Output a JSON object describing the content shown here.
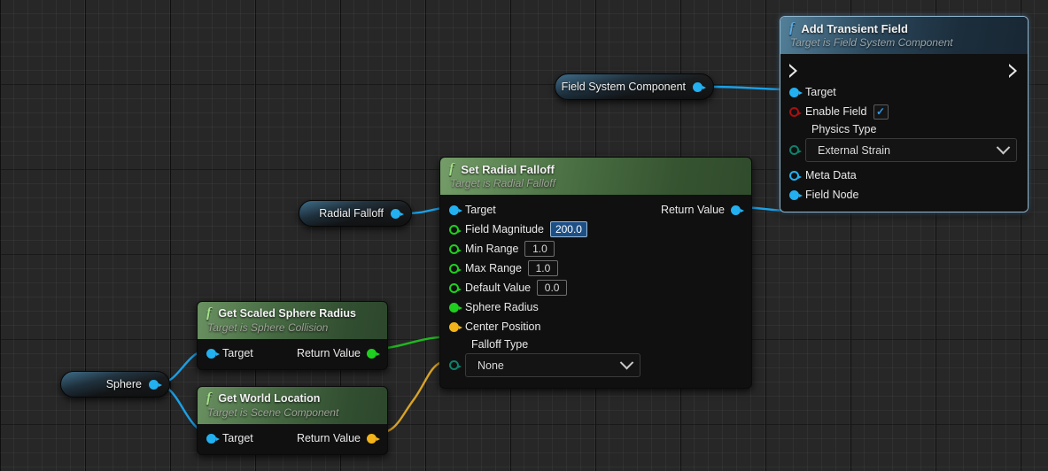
{
  "graph": {
    "name": "blueprint-event-graph",
    "background_color": "#272727",
    "grid_minor_color": "#303030",
    "grid_major_color": "#0d0d0d"
  },
  "colors": {
    "pin_object": "#23b0f0",
    "pin_bool": "#a61010",
    "pin_enum": "#0f806a",
    "pin_float": "#1fcf1f",
    "pin_vector": "#f2b418",
    "wire_object": "#1ba0e6",
    "wire_float": "#1fb81f",
    "wire_vector": "#d9a326",
    "header_function_blue": "#3e6e8e",
    "header_function_green": "#6d9c5e",
    "selection_highlight": "#1d4f85"
  },
  "nodes": {
    "add_transient_field": {
      "title": "Add Transient Field",
      "subtitle": "Target is Field System Component",
      "fn_glyph": "f",
      "selected": true,
      "exec_in": "exec-in-pin",
      "exec_out": "exec-out-pin",
      "pins": [
        {
          "label": "Target",
          "type": "object",
          "style": "filled",
          "widget": "none"
        },
        {
          "label": "Enable Field",
          "type": "bool",
          "style": "hollow",
          "widget": "checkbox",
          "checked": true
        },
        {
          "label": "Physics Type",
          "type": "enum",
          "style": "hollow",
          "widget": "combo",
          "value": "External Strain"
        },
        {
          "label": "Meta Data",
          "type": "object",
          "style": "hollow",
          "widget": "none"
        },
        {
          "label": "Field Node",
          "type": "object",
          "style": "filled",
          "widget": "none"
        }
      ]
    },
    "set_radial_falloff": {
      "title": "Set Radial Falloff",
      "subtitle": "Target is Radial Falloff",
      "fn_glyph": "f",
      "selected": false,
      "output_label": "Return Value",
      "pins": [
        {
          "label": "Target",
          "type": "object",
          "style": "filled",
          "widget": "none"
        },
        {
          "label": "Field Magnitude",
          "type": "float",
          "style": "hollow",
          "widget": "value",
          "value": "200.0",
          "focused": true
        },
        {
          "label": "Min Range",
          "type": "float",
          "style": "hollow",
          "widget": "value",
          "value": "1.0",
          "focused": false
        },
        {
          "label": "Max Range",
          "type": "float",
          "style": "hollow",
          "widget": "value",
          "value": "1.0",
          "focused": false
        },
        {
          "label": "Default Value",
          "type": "float",
          "style": "hollow",
          "widget": "value",
          "value": "0.0",
          "focused": false
        },
        {
          "label": "Sphere Radius",
          "type": "float",
          "style": "filled",
          "widget": "none"
        },
        {
          "label": "Center Position",
          "type": "vector",
          "style": "filled",
          "widget": "none"
        },
        {
          "label": "Falloff Type",
          "type": "enum",
          "style": "hollow",
          "widget": "combo",
          "value": "None"
        }
      ]
    },
    "get_scaled_sphere_radius": {
      "title": "Get Scaled Sphere Radius",
      "subtitle": "Target is Sphere Collision",
      "fn_glyph": "f",
      "input_label": "Target",
      "output_label": "Return Value"
    },
    "get_world_location": {
      "title": "Get World Location",
      "subtitle": "Target is Scene Component",
      "fn_glyph": "f",
      "input_label": "Target",
      "output_label": "Return Value"
    }
  },
  "variables": {
    "sphere": {
      "label": "Sphere",
      "type": "object"
    },
    "radial_falloff": {
      "label": "Radial Falloff",
      "type": "object"
    },
    "field_system_component": {
      "label": "Field System Component",
      "type": "object"
    }
  }
}
